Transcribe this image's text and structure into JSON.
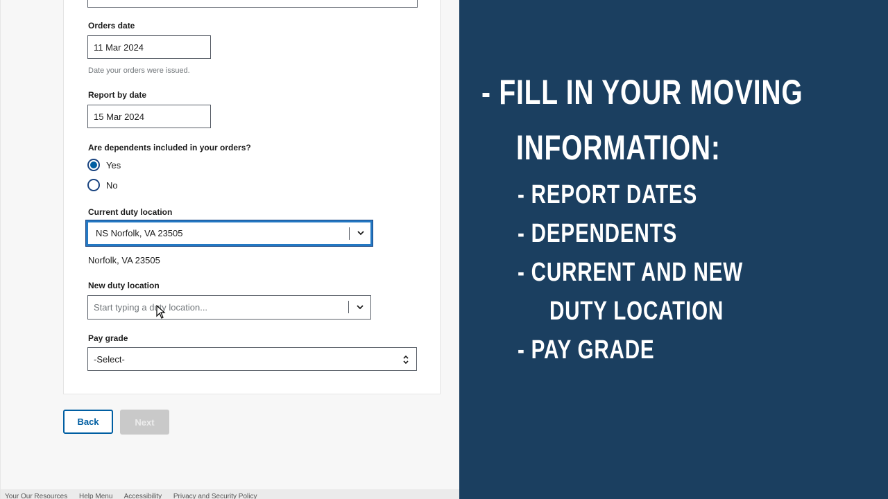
{
  "form": {
    "orders_date": {
      "label": "Orders date",
      "value": "11 Mar 2024",
      "hint": "Date your orders were issued."
    },
    "report_by_date": {
      "label": "Report by date",
      "value": "15 Mar 2024"
    },
    "dependents": {
      "question": "Are dependents included in your orders?",
      "options": [
        "Yes",
        "No"
      ],
      "selected": "Yes"
    },
    "current_duty_location": {
      "label": "Current duty location",
      "value": "NS Norfolk, VA 23505",
      "detail": "Norfolk, VA 23505"
    },
    "new_duty_location": {
      "label": "New duty location",
      "placeholder": "Start typing a duty location..."
    },
    "pay_grade": {
      "label": "Pay grade",
      "value": "-Select-"
    }
  },
  "buttons": {
    "back": "Back",
    "next": "Next"
  },
  "footer": {
    "links": [
      "Your Our Resources",
      "Help Menu",
      "Accessibility",
      "Privacy and Security Policy"
    ]
  },
  "slide": {
    "line1": "- FILL IN YOUR MOVING",
    "line2": "INFORMATION:",
    "bullets": [
      "- REPORT DATES",
      "- DEPENDENTS",
      "- CURRENT AND NEW",
      "DUTY LOCATION",
      "- PAY GRADE"
    ]
  },
  "colors": {
    "slide_bg": "#1b3f60",
    "primary": "#005ea2",
    "focus": "#2378c3"
  },
  "icons": {
    "combo_toggle": "chevron-down-icon",
    "select_toggle": "up-down-arrows-icon",
    "pointer": "mouse-cursor-icon"
  }
}
